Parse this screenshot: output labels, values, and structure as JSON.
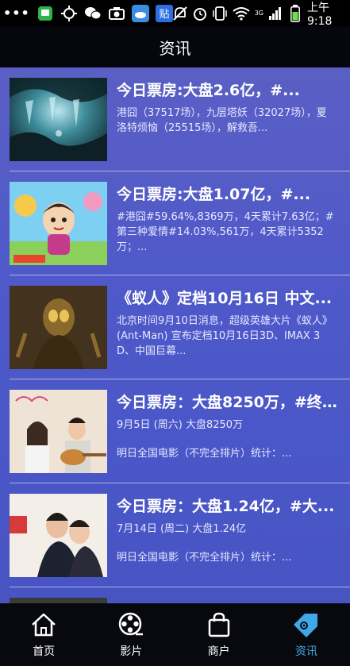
{
  "status_bar": {
    "dots": "•••",
    "signal_label": "3G",
    "time": "上午9:18"
  },
  "header": {
    "title": "资讯"
  },
  "news": [
    {
      "title": "今日票房:大盘2.6亿，#...",
      "desc": "港囧（37517场），九层塔妖（32027场），夏洛特烦恼（25515场），解救吾..."
    },
    {
      "title": "今日票房:大盘1.07亿，#...",
      "desc": "#港囧#59.64%,8369万，4天累计7.63亿；#第三种爱情#14.03%,561万，4天累计5352万；..."
    },
    {
      "title": "《蚁人》定档10月16日 中文...",
      "desc": "北京时间9月10日消息，超级英雄大片《蚁人》(Ant-Man) 宣布定档10月16日3D、IMAX 3D、中国巨幕..."
    },
    {
      "title": "今日票房：大盘8250万，#终...",
      "date": "9月5日 (周六) 大盘8250万",
      "sub": "明日全国电影（不完全排片）统计：..."
    },
    {
      "title": "今日票房：大盘1.24亿，#大...",
      "date": "7月14日 (周二) 大盘1.24亿",
      "sub": "明日全国电影（不完全排片）统计：..."
    }
  ],
  "tabs": [
    {
      "label": "首页",
      "icon": "home-icon"
    },
    {
      "label": "影片",
      "icon": "film-reel-icon"
    },
    {
      "label": "商户",
      "icon": "shopping-bag-icon"
    },
    {
      "label": "资讯",
      "icon": "news-tag-icon"
    }
  ],
  "colors": {
    "content_bg": "#4f59c9",
    "active_tab": "#3fa8e6"
  }
}
